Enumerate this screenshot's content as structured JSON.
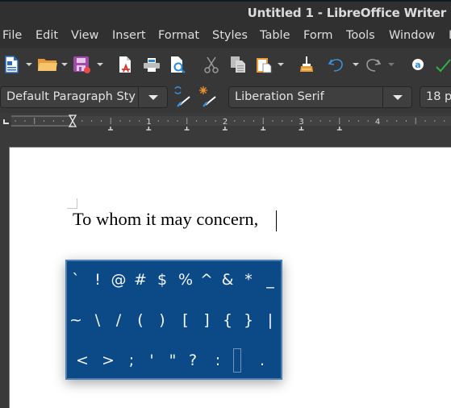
{
  "window": {
    "title": "Untitled 1 - LibreOffice Writer"
  },
  "menu": [
    "File",
    "Edit",
    "View",
    "Insert",
    "Format",
    "Styles",
    "Table",
    "Form",
    "Tools",
    "Window",
    "H"
  ],
  "toolbar": {
    "icons": [
      "new-document-icon",
      "open-folder-icon",
      "save-icon",
      "export-pdf-icon",
      "print-icon",
      "print-preview-icon",
      "cut-icon",
      "copy-icon",
      "paste-icon",
      "clone-formatting-icon",
      "undo-icon",
      "redo-icon",
      "autocorrect-icon",
      "spellcheck-icon"
    ]
  },
  "formatting": {
    "paragraph_style": "Default Paragraph Sty",
    "font_name": "Liberation Serif",
    "font_size": "18 p"
  },
  "ruler": {
    "labels": [
      "1",
      "2",
      "3",
      "4"
    ]
  },
  "document": {
    "text": "To whom it may concern,"
  },
  "char_panel": {
    "rows": [
      [
        "`",
        "!",
        "@",
        "#",
        "$",
        "%",
        "^",
        "&",
        "*",
        "_"
      ],
      [
        "~",
        "\\",
        "/",
        "(",
        ")",
        "[",
        "]",
        "{",
        "}",
        "|"
      ],
      [
        "<",
        ">",
        ";",
        "'",
        "\"",
        "?",
        ":",
        "",
        "."
      ]
    ],
    "selected": {
      "row": 2,
      "col": 7
    },
    "colors": {
      "background": "#0b4a87",
      "border": "#4e7fb3",
      "text": "#f3f6fa"
    }
  }
}
